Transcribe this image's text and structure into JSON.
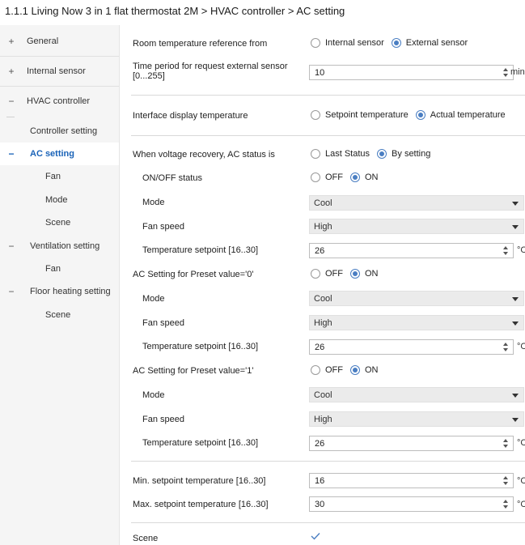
{
  "header": {
    "title": "1.1.1 Living Now 3 in 1 flat thermostat 2M > HVAC controller > AC setting"
  },
  "sidebar": {
    "items": [
      {
        "sign": "+",
        "label": "General"
      },
      {
        "sign": "+",
        "label": "Internal sensor"
      },
      {
        "sign": "−",
        "label": "HVAC controller"
      },
      {
        "sign": "",
        "label": "Controller setting"
      },
      {
        "sign": "−",
        "label": "AC setting"
      },
      {
        "sign": "",
        "label": "Fan"
      },
      {
        "sign": "",
        "label": "Mode"
      },
      {
        "sign": "",
        "label": "Scene"
      },
      {
        "sign": "−",
        "label": "Ventilation setting"
      },
      {
        "sign": "",
        "label": "Fan"
      },
      {
        "sign": "−",
        "label": "Floor heating setting"
      },
      {
        "sign": "",
        "label": "Scene"
      }
    ]
  },
  "form": {
    "room_temp_ref": {
      "label": "Room temperature reference from",
      "options": [
        "Internal sensor",
        "External sensor"
      ],
      "selected": "External sensor"
    },
    "time_period": {
      "label": "Time period for request external sensor [0...255]",
      "value": "10",
      "unit": "min"
    },
    "interface_display": {
      "label": "Interface display temperature",
      "options": [
        "Setpoint temperature",
        "Actual temperature"
      ],
      "selected": "Actual temperature"
    },
    "voltage_recovery": {
      "label": "When voltage recovery, AC status is",
      "options": [
        "Last Status",
        "By setting"
      ],
      "selected": "By setting",
      "onoff": {
        "label": "ON/OFF status",
        "options": [
          "OFF",
          "ON"
        ],
        "selected": "ON"
      },
      "mode": {
        "label": "Mode",
        "value": "Cool"
      },
      "fan": {
        "label": "Fan speed",
        "value": "High"
      },
      "setpoint": {
        "label": "Temperature setpoint [16..30]",
        "value": "26",
        "unit": "°C"
      }
    },
    "preset0": {
      "label": "AC Setting for Preset value='0'",
      "options": [
        "OFF",
        "ON"
      ],
      "selected": "ON",
      "mode": {
        "label": "Mode",
        "value": "Cool"
      },
      "fan": {
        "label": "Fan speed",
        "value": "High"
      },
      "setpoint": {
        "label": "Temperature setpoint [16..30]",
        "value": "26",
        "unit": "°C"
      }
    },
    "preset1": {
      "label": "AC Setting for Preset value='1'",
      "options": [
        "OFF",
        "ON"
      ],
      "selected": "ON",
      "mode": {
        "label": "Mode",
        "value": "Cool"
      },
      "fan": {
        "label": "Fan speed",
        "value": "High"
      },
      "setpoint": {
        "label": "Temperature setpoint [16..30]",
        "value": "26",
        "unit": "°C"
      }
    },
    "min_setpoint": {
      "label": "Min. setpoint temperature [16..30]",
      "value": "16",
      "unit": "°C"
    },
    "max_setpoint": {
      "label": "Max. setpoint temperature [16..30]",
      "value": "30",
      "unit": "°C"
    },
    "scene": {
      "label": "Scene",
      "checked": true
    }
  },
  "colors": {
    "accent": "#1a63b8",
    "radio": "#4a7ec2",
    "sidebar_bg": "#f5f5f5"
  }
}
